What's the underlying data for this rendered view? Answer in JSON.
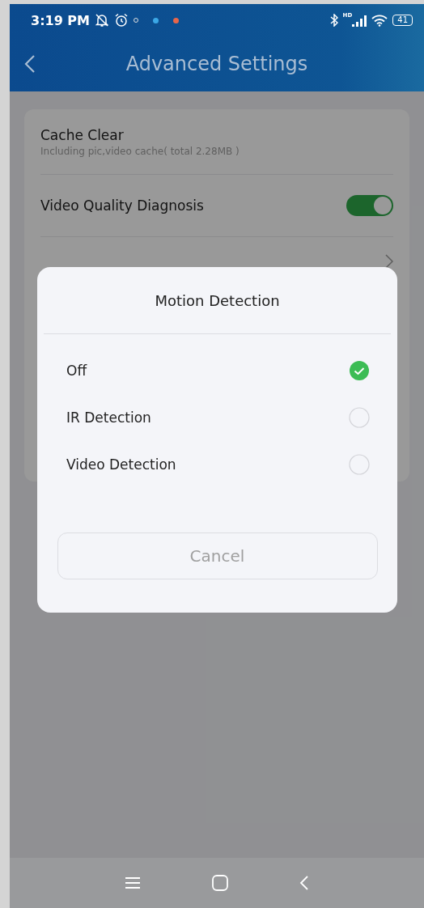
{
  "status_bar": {
    "time": "3:19 PM",
    "network": "HD",
    "battery": "41"
  },
  "header": {
    "title": "Advanced Settings"
  },
  "settings": [
    {
      "kind": "info",
      "title": "Cache Clear",
      "subtitle": "Including pic,video cache( total 2.28MB )"
    },
    {
      "kind": "toggle",
      "title": "Video Quality Diagnosis",
      "on": true
    },
    {
      "kind": "link"
    }
  ],
  "dialog": {
    "title": "Motion Detection",
    "options": [
      {
        "label": "Off",
        "selected": true
      },
      {
        "label": "IR Detection",
        "selected": false
      },
      {
        "label": "Video Detection",
        "selected": false
      }
    ],
    "cancel": "Cancel"
  }
}
